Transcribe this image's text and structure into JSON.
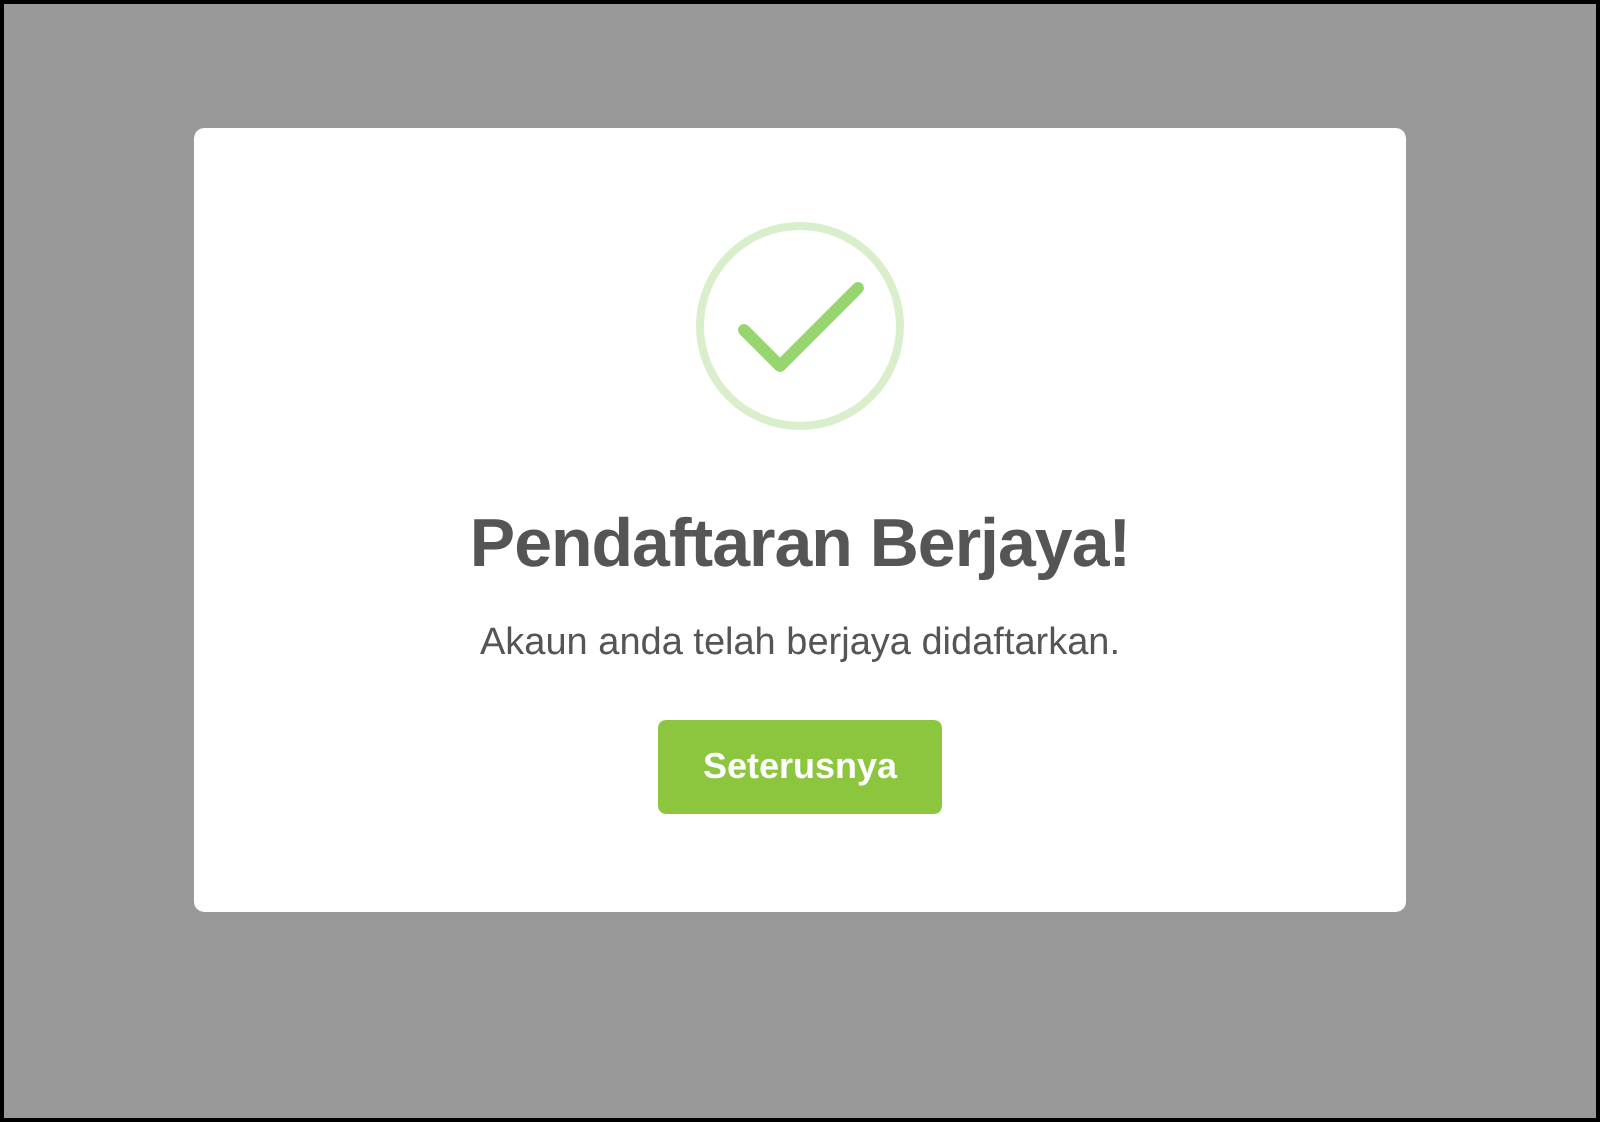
{
  "dialog": {
    "title": "Pendaftaran Berjaya!",
    "message": "Akaun anda telah berjaya didaftarkan.",
    "button": {
      "label": "Seterusnya"
    }
  }
}
